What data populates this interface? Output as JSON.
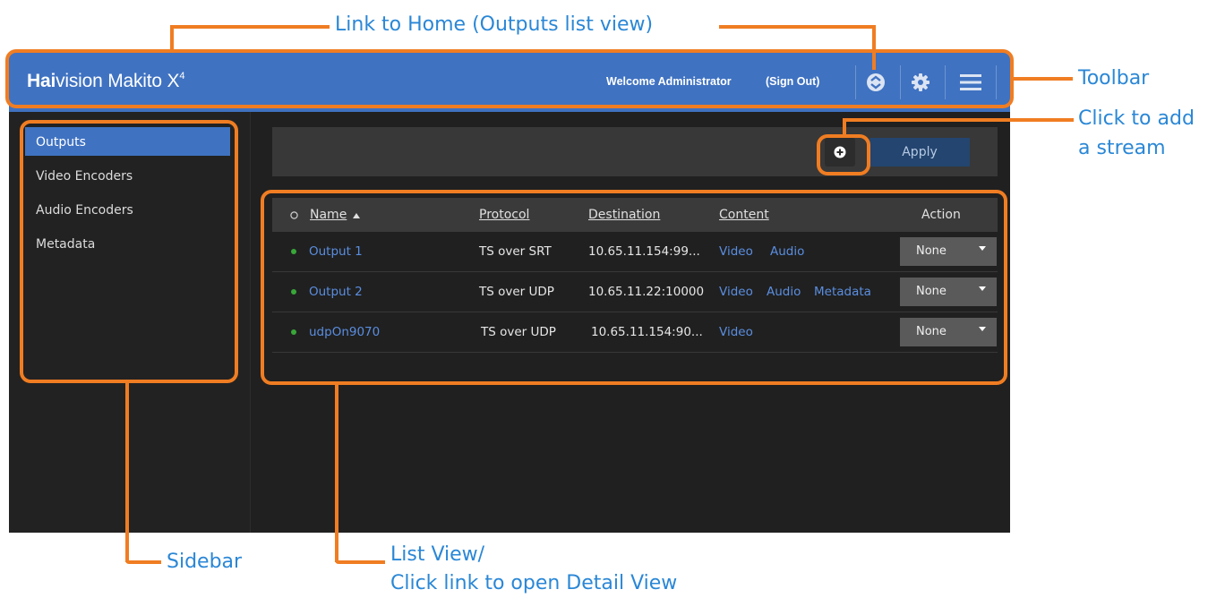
{
  "toolbar": {
    "brand_bold": "Hai",
    "brand_rest": "vision Makito X",
    "brand_sup": "4",
    "welcome": "Welcome Administrator",
    "sign_out": "(Sign Out)",
    "icons": [
      "home-icon",
      "gear-icon",
      "hamburger-menu-icon"
    ]
  },
  "sidebar": {
    "items": [
      {
        "label": "Outputs",
        "active": true
      },
      {
        "label": "Video Encoders",
        "active": false
      },
      {
        "label": "Audio Encoders",
        "active": false
      },
      {
        "label": "Metadata",
        "active": false
      }
    ]
  },
  "actionbar": {
    "add_icon": "plus-circle-icon",
    "apply": "Apply"
  },
  "table": {
    "columns": {
      "name": "Name",
      "protocol": "Protocol",
      "destination": "Destination",
      "content": "Content",
      "action": "Action"
    },
    "rows": [
      {
        "name": "Output 1",
        "protocol": "TS over SRT",
        "destination": "10.65.11.154:99...",
        "content": [
          "Video",
          "Audio"
        ],
        "action": "None"
      },
      {
        "name": "Output 2",
        "protocol": "TS over UDP",
        "destination": "10.65.11.22:10000",
        "content": [
          "Video",
          "Audio",
          "Metadata"
        ],
        "action": "None"
      },
      {
        "name": "udpOn9070",
        "protocol": "TS over UDP",
        "destination": "10.65.11.154:90...",
        "content": [
          "Video"
        ],
        "action": "None"
      }
    ]
  },
  "callouts": {
    "home": "Link to Home (Outputs list view)",
    "toolbar": "Toolbar",
    "add_line1": "Click to add",
    "add_line2": "a stream",
    "sidebar": "Sidebar",
    "list_line1": "List View/",
    "list_line2": "Click link to open Detail View"
  },
  "colors": {
    "toolbar": "#3f72c1",
    "callout": "#f07d22",
    "label": "#2a87d6",
    "link": "#5a8ee0",
    "status": "#38a838"
  }
}
